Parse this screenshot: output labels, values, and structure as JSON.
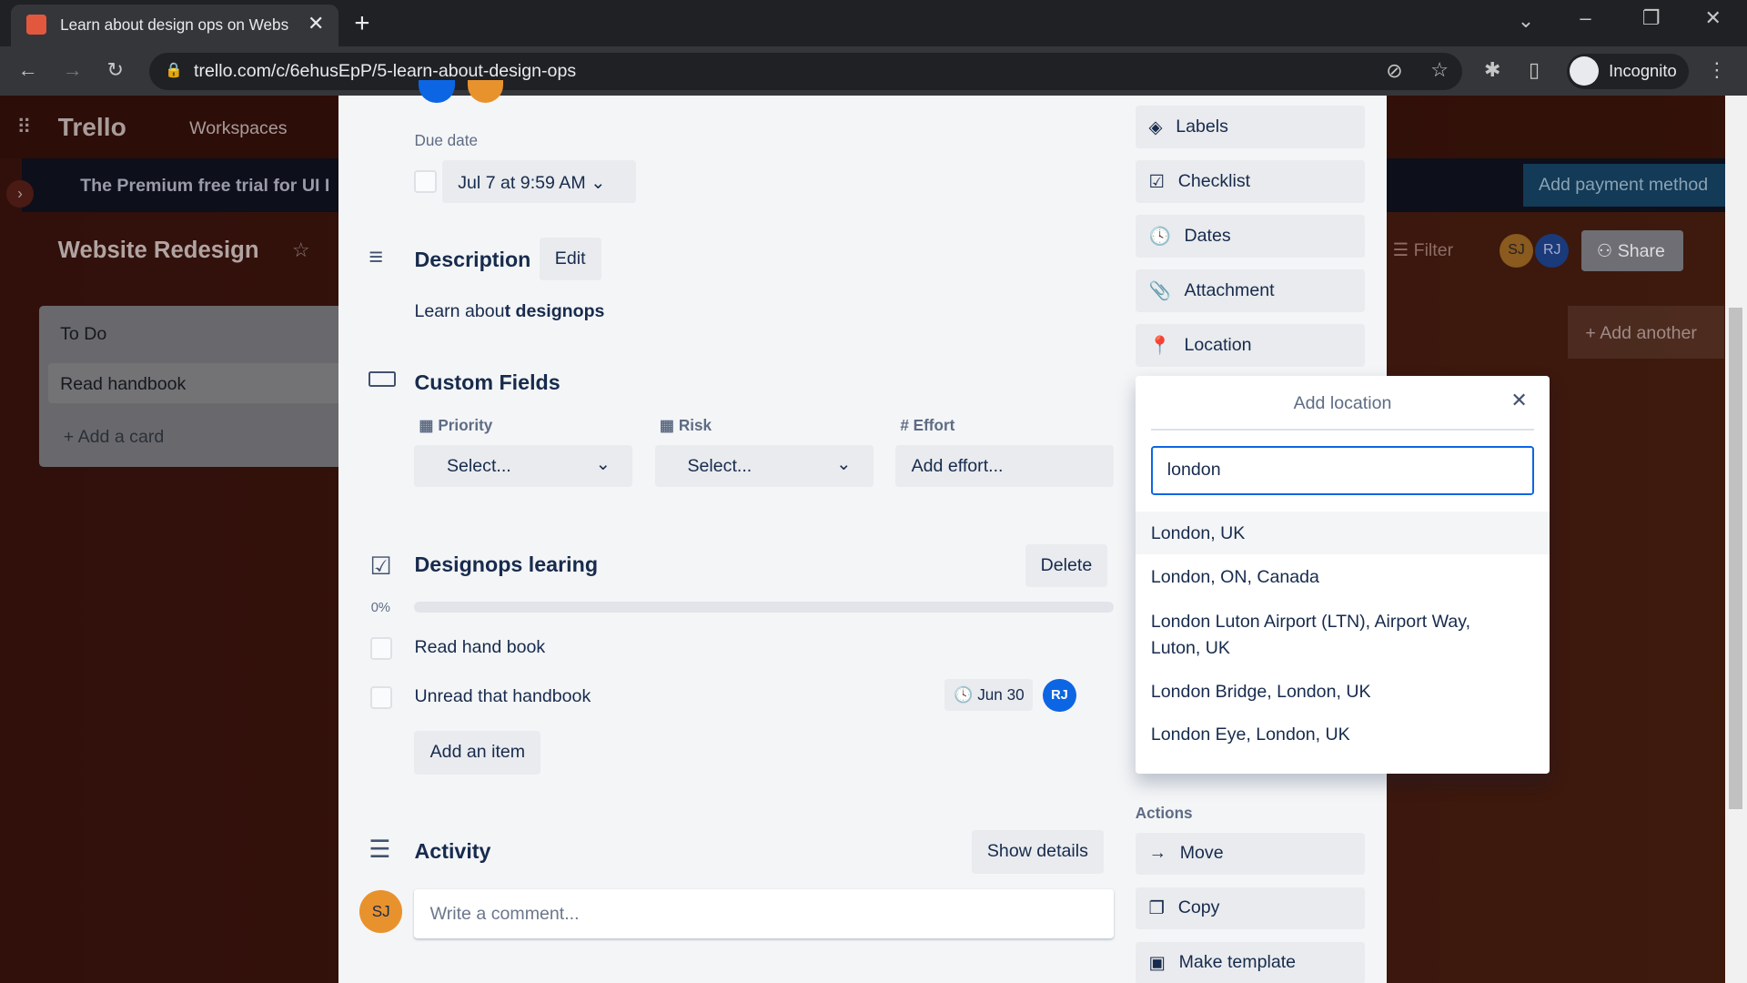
{
  "browser": {
    "tab_title": "Learn about design ops on Webs",
    "url": "trello.com/c/6ehusEpP/5-learn-about-design-ops",
    "profile": "Incognito"
  },
  "board": {
    "app": "Trello",
    "workspaces": "Workspaces",
    "title": "Website Redesign",
    "banner": "The Premium free trial for UI I",
    "add_payment": "Add payment method",
    "filter": "Filter",
    "share": "Share",
    "members": [
      "SJ",
      "RJ"
    ],
    "list_title": "To Do",
    "card": "Read handbook",
    "add_card": "Add a card",
    "add_another": "Add another"
  },
  "card": {
    "due_label": "Due date",
    "due_value": "Jul 7 at 9:59 AM",
    "description_title": "Description",
    "edit": "Edit",
    "description_plain": "Learn abou",
    "description_bold": "t designops",
    "custom_fields_title": "Custom Fields",
    "fields": [
      {
        "label": "Priority",
        "value": "Select..."
      },
      {
        "label": "Risk",
        "value": "Select..."
      },
      {
        "label": "Effort",
        "value": "Add effort..."
      }
    ],
    "checklist": {
      "title": "Designops learing",
      "delete": "Delete",
      "progress_label": "0%",
      "progress": 0,
      "items": [
        {
          "text": "Read hand book",
          "checked": false
        },
        {
          "text": "Unread that handbook",
          "checked": false,
          "due": "Jun 30",
          "member": "RJ"
        }
      ],
      "add_item": "Add an item"
    },
    "activity": {
      "title": "Activity",
      "show_details": "Show details",
      "comment_placeholder": "Write a comment...",
      "avatar": "SJ"
    }
  },
  "sidebar": {
    "items": [
      "Labels",
      "Checklist",
      "Dates",
      "Attachment",
      "Location"
    ],
    "actions_label": "Actions",
    "actions": [
      "Move",
      "Copy",
      "Make template"
    ]
  },
  "location_popup": {
    "title": "Add location",
    "query": "london",
    "suggestions": [
      "London, UK",
      "London, ON, Canada",
      "London Luton Airport (LTN), Airport Way,",
      "Luton, UK",
      "London Bridge, London, UK",
      "London Eye, London, UK"
    ]
  },
  "colors": {
    "accent": "#0c66e4",
    "avatar_sj": "#e8922e",
    "avatar_rj": "#0c66e4"
  }
}
